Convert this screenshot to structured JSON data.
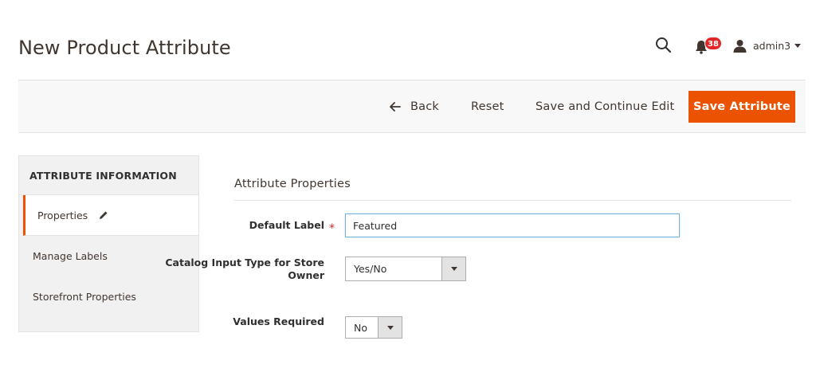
{
  "header": {
    "page_title": "New Product Attribute",
    "notifications_count": "38",
    "username": "admin3"
  },
  "actions": {
    "back_label": "Back",
    "reset_label": "Reset",
    "save_continue_label": "Save and Continue Edit",
    "save_label": "Save Attribute",
    "accent_color": "#eb5202"
  },
  "sidebar": {
    "title": "ATTRIBUTE INFORMATION",
    "tabs": [
      {
        "label": "Properties",
        "active": true
      },
      {
        "label": "Manage Labels",
        "active": false
      },
      {
        "label": "Storefront Properties",
        "active": false
      }
    ]
  },
  "form": {
    "section_title": "Attribute Properties",
    "default_label": {
      "label": "Default Label",
      "required_marker": "*",
      "value": "Featured"
    },
    "catalog_input_type": {
      "label": "Catalog Input Type for Store Owner",
      "selected": "Yes/No"
    },
    "values_required": {
      "label": "Values Required",
      "selected": "No"
    }
  }
}
